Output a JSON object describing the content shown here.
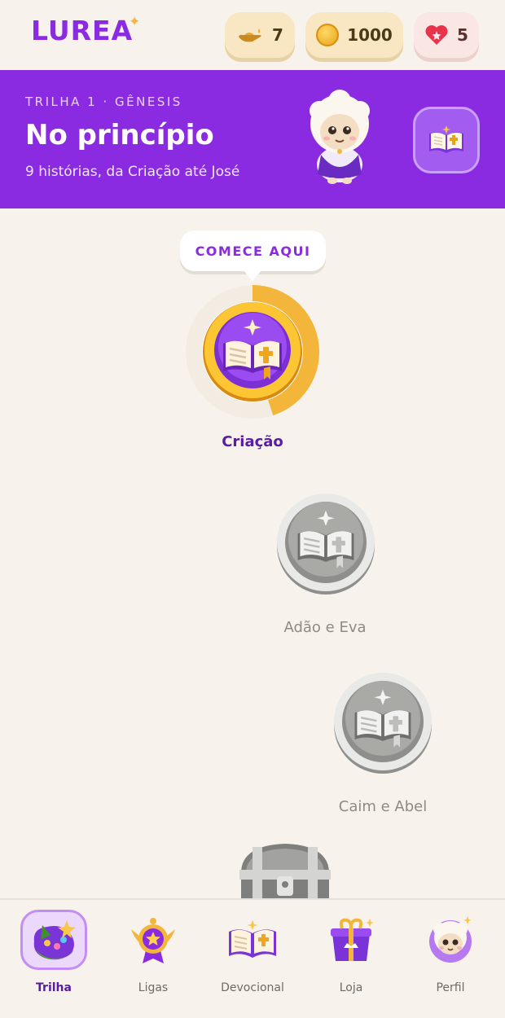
{
  "header": {
    "logo": "LUREA",
    "stats": {
      "lamps": "7",
      "coins": "1000",
      "lives": "5"
    }
  },
  "banner": {
    "kicker": "TRILHA 1 · GÊNESIS",
    "title": "No princípio",
    "subtitle": "9 histórias, da Criação até José"
  },
  "path": {
    "tooltip": "COMECE AQUI",
    "nodes": [
      {
        "label": "Criação",
        "state": "current",
        "progress": 0.45
      },
      {
        "label": "Adão e Eva",
        "state": "locked"
      },
      {
        "label": "Caim e Abel",
        "state": "locked"
      }
    ]
  },
  "nav": {
    "items": [
      {
        "label": "Trilha",
        "selected": true
      },
      {
        "label": "Ligas"
      },
      {
        "label": "Devocional"
      },
      {
        "label": "Loja"
      },
      {
        "label": "Perfil"
      }
    ]
  },
  "colors": {
    "brand": "#8a2be2",
    "background": "#f7f3ec",
    "progress": "#f3b53a"
  }
}
